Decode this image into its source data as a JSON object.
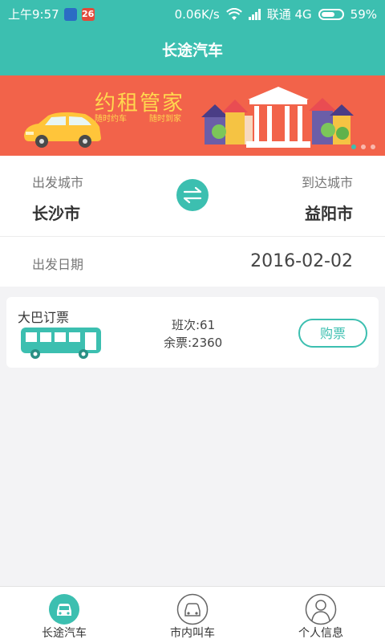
{
  "status_bar": {
    "time": "上午9:57",
    "calendar_day": "26",
    "network_speed": "0.06K/s",
    "carrier": "联通 4G",
    "battery": "59%"
  },
  "header": {
    "title": "长途汽车"
  },
  "banner": {
    "title": "约租管家",
    "subtitle_left": "随时约车",
    "subtitle_right": "随时到家",
    "page_count": 3,
    "active_page": 1
  },
  "route": {
    "origin_label": "出发城市",
    "origin_city": "长沙市",
    "destination_label": "到达城市",
    "destination_city": "益阳市"
  },
  "date": {
    "label": "出发日期",
    "value": "2016-02-02"
  },
  "ticket": {
    "title": "大巴订票",
    "trips": "班次:61",
    "remaining": "余票:2360",
    "buy_label": "购票"
  },
  "bottom_nav": {
    "items": [
      {
        "label": "长途汽车",
        "icon": "bus-car-icon",
        "active": true
      },
      {
        "label": "市内叫车",
        "icon": "car-icon",
        "active": false
      },
      {
        "label": "个人信息",
        "icon": "person-icon",
        "active": false
      }
    ]
  },
  "colors": {
    "primary": "#3cbfb0",
    "banner_bg": "#f2634a",
    "banner_text": "#ffd84f",
    "text_dark": "#333333",
    "text_grey": "#777777"
  }
}
